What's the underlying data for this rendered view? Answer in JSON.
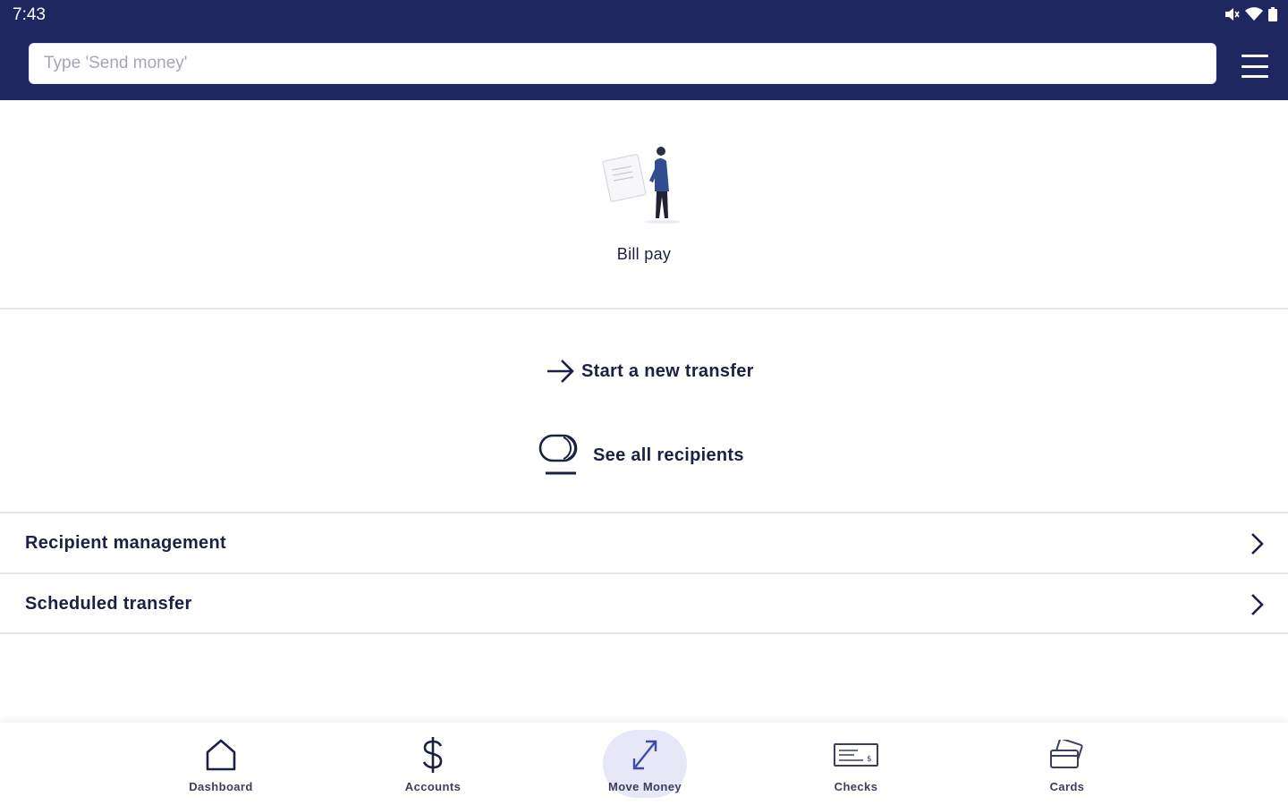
{
  "status_bar": {
    "time": "7:43"
  },
  "search": {
    "placeholder": "Type 'Send money'"
  },
  "bill_pay": {
    "label": "Bill pay"
  },
  "actions": {
    "start_transfer": "Start a new transfer",
    "see_recipients": "See all recipients"
  },
  "list": [
    {
      "label": "Recipient management"
    },
    {
      "label": "Scheduled transfer"
    }
  ],
  "bottom_nav": [
    {
      "label": "Dashboard",
      "icon": "home-icon"
    },
    {
      "label": "Accounts",
      "icon": "dollar-icon"
    },
    {
      "label": "Move Money",
      "icon": "move-money-icon",
      "active": true
    },
    {
      "label": "Checks",
      "icon": "check-icon"
    },
    {
      "label": "Cards",
      "icon": "cards-icon"
    }
  ],
  "colors": {
    "header": "#1f2761",
    "text": "#1b2144",
    "active_tab": "#e8e7f8"
  }
}
